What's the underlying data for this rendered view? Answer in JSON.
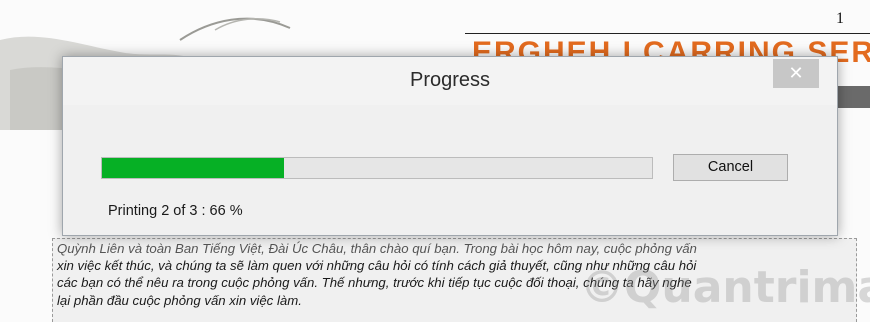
{
  "document": {
    "page_number": "1",
    "banner_title": "ERGHEH LCARRING SERIES",
    "body_lines": [
      "Quỳnh Liên và toàn Ban Tiếng Việt, Đài Úc Châu, thân chào quí bạn. Trong bài học hôm nay, cuộc phỏng vấn",
      "xin việc kết thúc, và chúng ta sẽ làm quen với những câu hỏi có tính cách giả thuyết, cũng như những câu hỏi",
      "các bạn có thể nêu ra trong cuộc phỏng vấn. Thế nhưng, trước khi tiếp tục cuộc đối thoại, chúng ta hãy nghe",
      "lại phần đầu cuộc phỏng vấn xin việc làm."
    ],
    "watermark": "©Quantrimang"
  },
  "dialog": {
    "title": "Progress",
    "close_glyph": "✕",
    "cancel_label": "Cancel",
    "status": "Printing 2 of 3 : 66 %",
    "progress_fraction": 0.33,
    "accent_color": "#06b025"
  }
}
